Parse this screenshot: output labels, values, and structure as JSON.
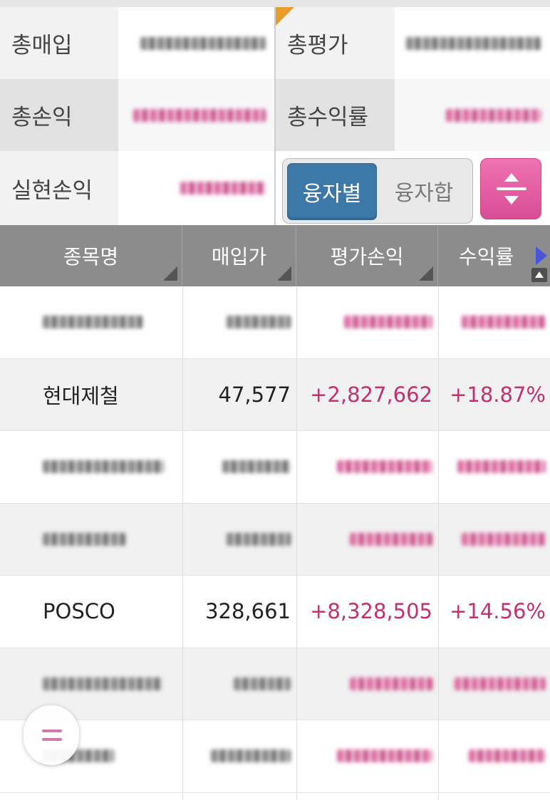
{
  "summary": {
    "total_buy_label": "총매입",
    "total_eval_label": "총평가",
    "total_pl_label": "총손익",
    "total_return_label": "총수익률",
    "realized_pl_label": "실현손익"
  },
  "toggle": {
    "by_loan_label": "융자별",
    "loan_sum_label": "융자합"
  },
  "table": {
    "headers": [
      "종목명",
      "매입가",
      "평가손익",
      "수익률"
    ],
    "rows": [
      {
        "name": "",
        "price": "",
        "pl": "",
        "rate": ""
      },
      {
        "name": "현대제철",
        "price": "47,577",
        "pl": "+2,827,662",
        "rate": "+18.87%"
      },
      {
        "name": "",
        "price": "",
        "pl": "",
        "rate": ""
      },
      {
        "name": "",
        "price": "",
        "pl": "",
        "rate": ""
      },
      {
        "name": "POSCO",
        "price": "328,661",
        "pl": "+8,328,505",
        "rate": "+14.56%"
      },
      {
        "name": "",
        "price": "",
        "pl": "",
        "rate": ""
      },
      {
        "name": "",
        "price": "",
        "pl": "",
        "rate": ""
      }
    ]
  },
  "colors": {
    "accent_blue": "#3d79a8",
    "accent_pink": "#d94d96",
    "positive": "#c2306f",
    "header_gray": "#8c8c8c"
  },
  "icons": {
    "sort_toggle": "sort-updown-icon",
    "scroll_right": "arrow-right-icon",
    "scroll_top": "arrow-up-icon",
    "floating_menu": "menu-icon"
  }
}
